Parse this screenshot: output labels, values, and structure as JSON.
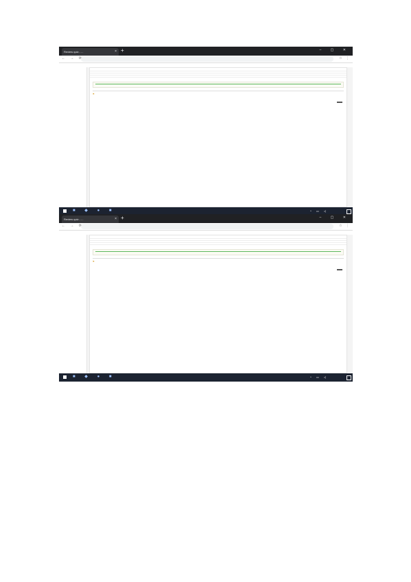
{
  "screens": [
    {
      "tab_title": "Review quiz - ...",
      "url": "",
      "breadcrumb": "",
      "sidebar": {
        "title": "",
        "items": [
          "",
          "",
          "",
          "",
          ""
        ],
        "sections": [
          "",
          "",
          ""
        ]
      },
      "summary": {
        "title": "",
        "rows": [
          {
            "key": "",
            "value": ""
          },
          {
            "key": "",
            "value": ""
          },
          {
            "key": "",
            "value": ""
          },
          {
            "key": "",
            "value": ""
          }
        ]
      },
      "feedback": {
        "text": "",
        "link": ""
      },
      "question": {
        "header": "",
        "meta": "",
        "id": "",
        "text": "",
        "options": [
          "",
          "",
          "",
          ""
        ],
        "points_label": "",
        "points_button": ""
      },
      "clock": {
        "time": "",
        "date": ""
      }
    },
    {
      "tab_title": "Review quiz - ...",
      "url": "",
      "breadcrumb": "",
      "sidebar": {
        "title": "",
        "items": [
          "",
          "",
          "",
          "",
          ""
        ],
        "sections": [
          "",
          "",
          ""
        ]
      },
      "summary": {
        "title": "",
        "rows": [
          {
            "key": "",
            "value": ""
          },
          {
            "key": "",
            "value": ""
          },
          {
            "key": "",
            "value": ""
          },
          {
            "key": "",
            "value": ""
          }
        ]
      },
      "feedback": {
        "text": "",
        "link": ""
      },
      "question": {
        "header": "",
        "meta": "",
        "id": "",
        "text": "",
        "options": [
          "",
          "",
          "",
          ""
        ],
        "points_label": "",
        "points_button": ""
      },
      "clock": {
        "time": "",
        "date": ""
      }
    }
  ]
}
